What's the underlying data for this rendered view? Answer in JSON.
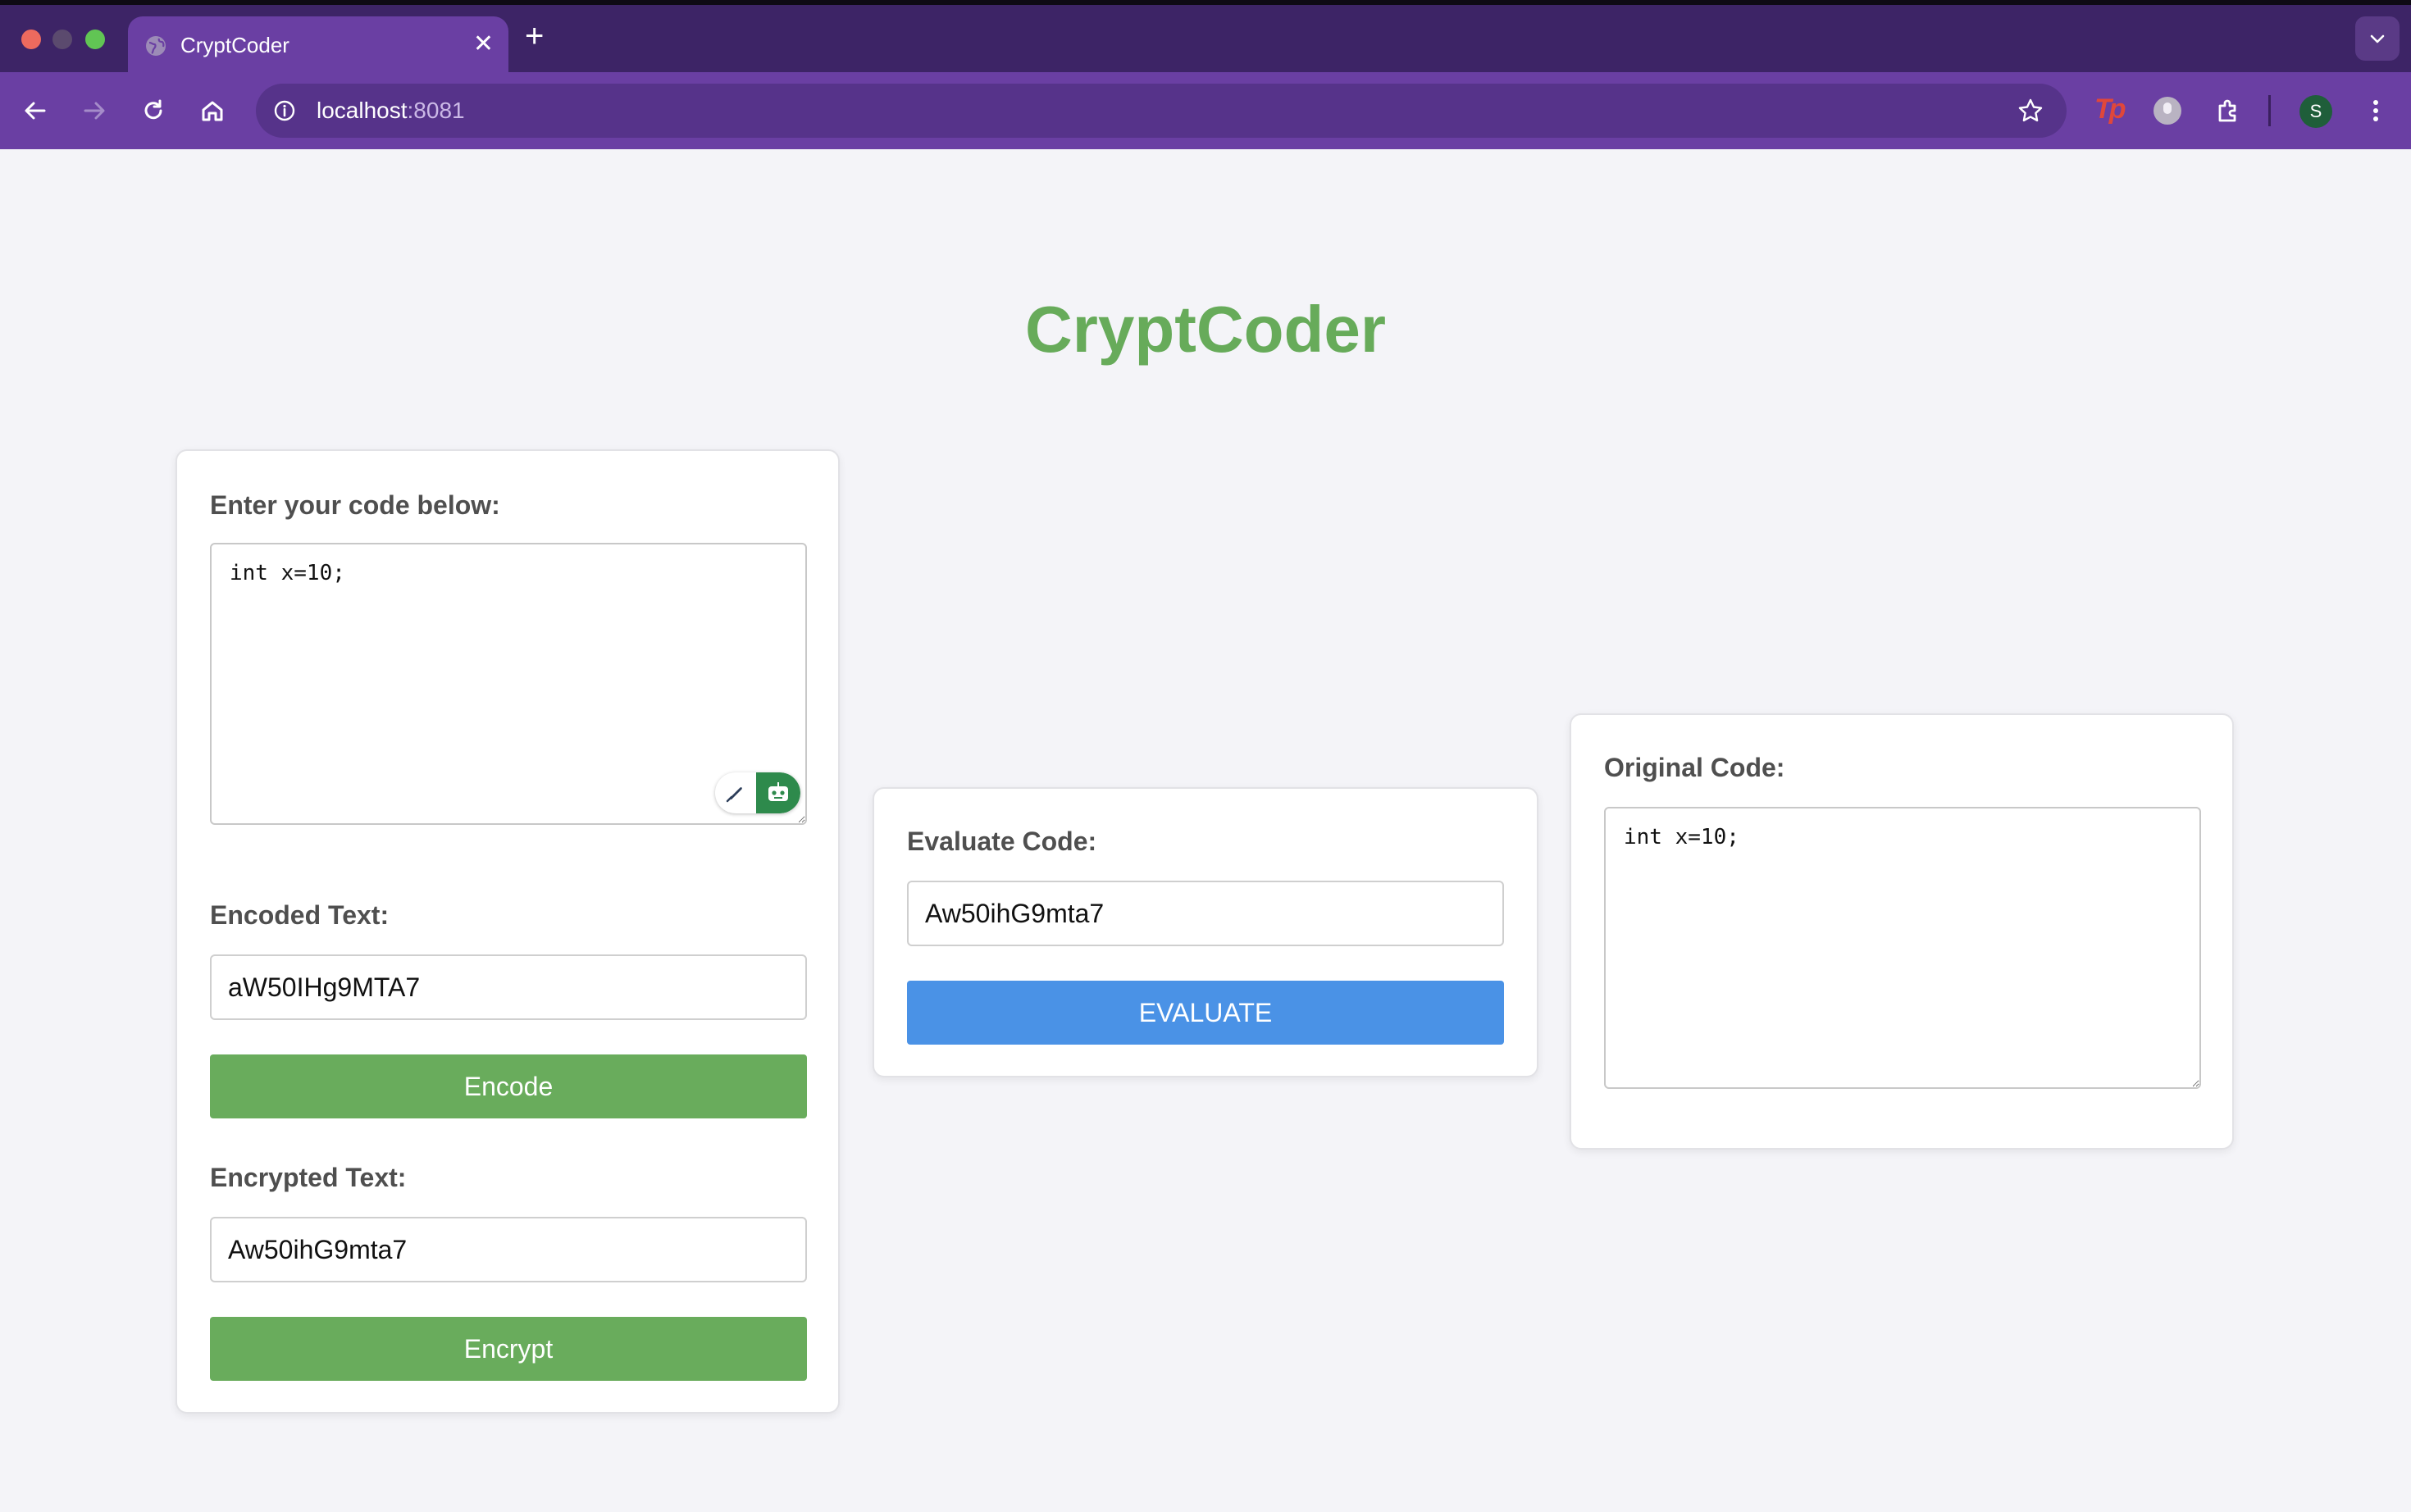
{
  "browser": {
    "tab_title": "CryptCoder",
    "tab_close_glyph": "✕",
    "new_tab_glyph": "+",
    "url_host": "localhost",
    "url_port": ":8081",
    "profile_initial": "S",
    "extension_label": "Tp",
    "icons": [
      "globe-icon",
      "back-icon",
      "forward-icon",
      "reload-icon",
      "home-icon",
      "info-icon",
      "star-icon",
      "extensions-icon",
      "menu-icon",
      "chevron-down-icon"
    ]
  },
  "page": {
    "title": "CryptCoder",
    "title_color": "#67ab5a"
  },
  "input_card": {
    "label": "Enter your code below:",
    "code": "int x=10;",
    "encoded_label": "Encoded Text:",
    "encoded_value": "aW50IHg9MTA7",
    "encode_button": "Encode",
    "encrypted_label": "Encrypted Text:",
    "encrypted_value": "Aw50ihG9mta7",
    "encrypt_button": "Encrypt"
  },
  "evaluate_card": {
    "label": "Evaluate Code:",
    "value": "Aw50ihG9mta7",
    "button": "EVALUATE"
  },
  "original_card": {
    "label": "Original Code:",
    "code": "int x=10;"
  },
  "colors": {
    "green_button": "#69ac5c",
    "blue_button": "#4a92e6",
    "chrome_purple": "#6a3fa3"
  }
}
